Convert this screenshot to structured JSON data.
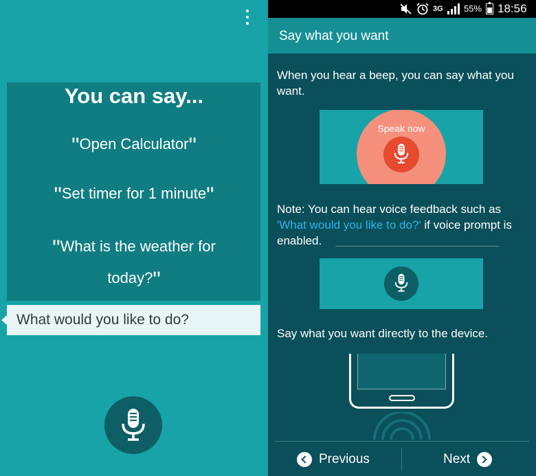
{
  "left": {
    "title": "You can say...",
    "examples": [
      "Open Calculator",
      "Set timer for 1 minute",
      "What is the weather for today?"
    ],
    "examples_line2": "today?",
    "examples_line1": "What is the weather for",
    "question": "What would you like to do?",
    "icons": [
      "more-vert-icon",
      "microphone-icon"
    ]
  },
  "status_bar": {
    "network": "3G",
    "battery": "55%",
    "time": "18:56",
    "icons": [
      "mute-icon",
      "alarm-icon",
      "signal-icon",
      "battery-icon"
    ]
  },
  "right": {
    "header_title": "Say what you want",
    "intro": "When you hear a beep, you can say what you want.",
    "speak_now": "Speak now",
    "note_prefix": "Note: You can hear voice feedback such as ",
    "note_link": "'What would you like to do?'",
    "note_suffix": " if voice prompt is enabled.",
    "direct": "Say what you want directly to the device.",
    "previous_label": "Previous",
    "next_label": "Next"
  },
  "colors": {
    "left_bg": "#17a3a8",
    "card_bg": "#0f7d82",
    "right_bg": "#0a4f5a",
    "header_bg": "#168f94",
    "speak_circle": "#f4907b",
    "speak_mic": "#e64a2f",
    "link": "#2fb4e6"
  }
}
